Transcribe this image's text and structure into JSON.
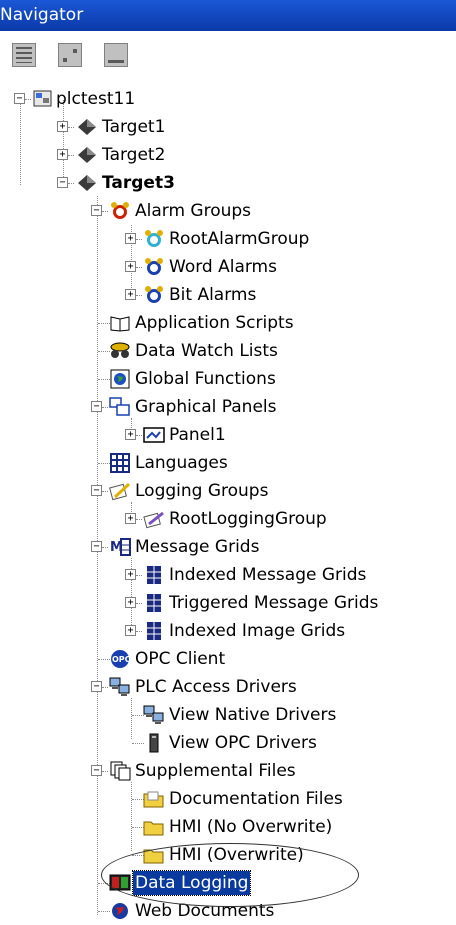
{
  "window": {
    "title": "Navigator"
  },
  "toolbar": {
    "buttons": [
      "grid-view-icon",
      "chart-view-icon",
      "panel-view-icon"
    ]
  },
  "tree": {
    "root": "plctest11",
    "targets": [
      "Target1",
      "Target2",
      "Target3"
    ],
    "items": {
      "alarm_groups": "Alarm Groups",
      "root_alarm_group": "RootAlarmGroup",
      "word_alarms": "Word Alarms",
      "bit_alarms": "Bit Alarms",
      "application_scripts": "Application Scripts",
      "data_watch_lists": "Data Watch Lists",
      "global_functions": "Global Functions",
      "graphical_panels": "Graphical Panels",
      "panel1": "Panel1",
      "languages": "Languages",
      "logging_groups": "Logging Groups",
      "root_logging_group": "RootLoggingGroup",
      "message_grids": "Message Grids",
      "indexed_message_grids": "Indexed Message Grids",
      "triggered_message_grids": "Triggered Message Grids",
      "indexed_image_grids": "Indexed Image Grids",
      "opc_client": "OPC Client",
      "plc_access_drivers": "PLC Access Drivers",
      "view_native_drivers": "View Native Drivers",
      "view_opc_drivers": "View OPC Drivers",
      "supplemental_files": "Supplemental Files",
      "documentation_files": "Documentation Files",
      "hmi_no_overwrite": "HMI (No Overwrite)",
      "hmi_overwrite": "HMI (Overwrite)",
      "data_logging": "Data Logging",
      "web_documents": "Web Documents"
    },
    "selected": "Data Logging"
  },
  "icon_colors": {
    "selection": "#0b3a9e",
    "alarm": "#cc2200",
    "folder": "#f0d040"
  }
}
